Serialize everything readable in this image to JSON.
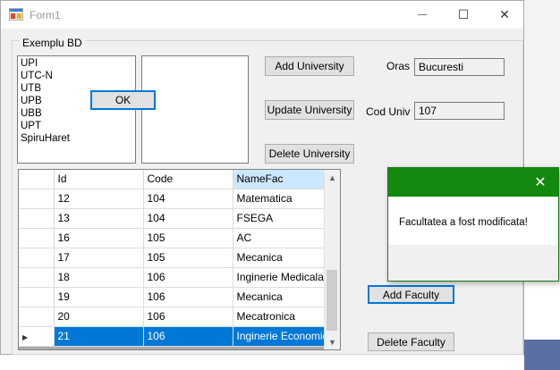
{
  "window": {
    "title": "Form1",
    "minimize_glyph": "—",
    "maximize_glyph": "☐",
    "close_glyph": "✕"
  },
  "group": {
    "label": "Exemplu BD"
  },
  "universities": [
    "UPI",
    "UTC-N",
    "UTB",
    "UPB",
    "UBB",
    "UPT",
    "SpiruHaret"
  ],
  "buttons": {
    "add_university": "Add University",
    "update_university": "Update University",
    "delete_university": "Delete University",
    "add_faculty": "Add Faculty",
    "delete_faculty": "Delete Faculty"
  },
  "fields": {
    "oras_label": "Oras",
    "oras_value": "Bucuresti",
    "cod_label": "Cod Univ",
    "cod_value": "107"
  },
  "grid": {
    "columns": [
      "Id",
      "Code",
      "NameFac"
    ],
    "rows": [
      {
        "id": "12",
        "code": "104",
        "name": "Matematica"
      },
      {
        "id": "13",
        "code": "104",
        "name": "FSEGA"
      },
      {
        "id": "16",
        "code": "105",
        "name": "AC"
      },
      {
        "id": "17",
        "code": "105",
        "name": "Mecanica"
      },
      {
        "id": "18",
        "code": "106",
        "name": "Inginerie Medicala"
      },
      {
        "id": "19",
        "code": "106",
        "name": "Mecanica"
      },
      {
        "id": "20",
        "code": "106",
        "name": "Mecatronica"
      },
      {
        "id": "21",
        "code": "106",
        "name": "Inginerie Economica"
      }
    ],
    "selected_row_index": 7,
    "row_indicator": "▶"
  },
  "dialog": {
    "message": "Facultatea a fost modificata!",
    "ok_label": "OK",
    "close_glyph": "✕"
  },
  "colors": {
    "dialog_title": "#13890f",
    "selection": "#0078d7",
    "focus_border": "#0078d7"
  }
}
